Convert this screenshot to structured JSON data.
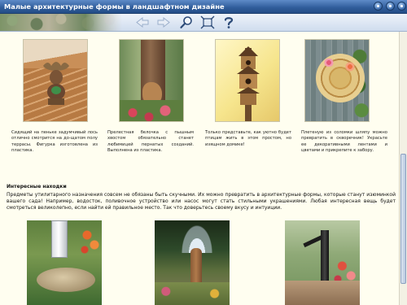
{
  "window": {
    "title": "Малые архитектурные формы в ландшафтном дизайне"
  },
  "toolbar": {
    "icons": [
      "back-arrow-icon",
      "forward-arrow-icon",
      "magnifier-icon",
      "fit-frame-icon",
      "question-mark-icon"
    ]
  },
  "gallery_top": {
    "items": [
      {
        "icon": "moose-figure-photo",
        "caption": "Сидящий на пеньке задумчивый лось отлично смотрится на до-щатом полу террасы. Фигурка изготовлена из пластика."
      },
      {
        "icon": "squirrel-on-tree-photo",
        "caption": "Прелестная белочка с пышным хвостом обязательно станет любимицей пернатых созданий. Выполнена из пластика."
      },
      {
        "icon": "birdhouse-photo",
        "caption": "Только представьте, как уютно будет птицам жить в этом простом, но изящном домике!"
      },
      {
        "icon": "woven-hat-photo",
        "caption": "Плетеную из соломки шляпу можно превратить в скворечник! Украсьте ее декоративными лентами и цветами и прикрепите к забору."
      }
    ]
  },
  "section": {
    "heading": "Интересные находки",
    "text": "Предметы утилитарного назначения совсем не обязаны быть скучными. Их можно превратить в архитектурные формы, которые станут изюминкой вашего сада! Например, водосток, поливочное устройство или насос могут стать стильными украшениями. Любая интересная вещь будет смотреться великолепно, если найти ей правильное место. Так что доверьтесь своему вкусу и интуиции."
  },
  "gallery_bottom": {
    "items": [
      {
        "icon": "downspout-birdbath-photo"
      },
      {
        "icon": "fountain-statue-photo"
      },
      {
        "icon": "hand-pump-photo"
      }
    ]
  },
  "colors": {
    "titlebar": "#2f5c9a",
    "content_background": "#fffef0",
    "toolbar": "#dfe8f5"
  }
}
